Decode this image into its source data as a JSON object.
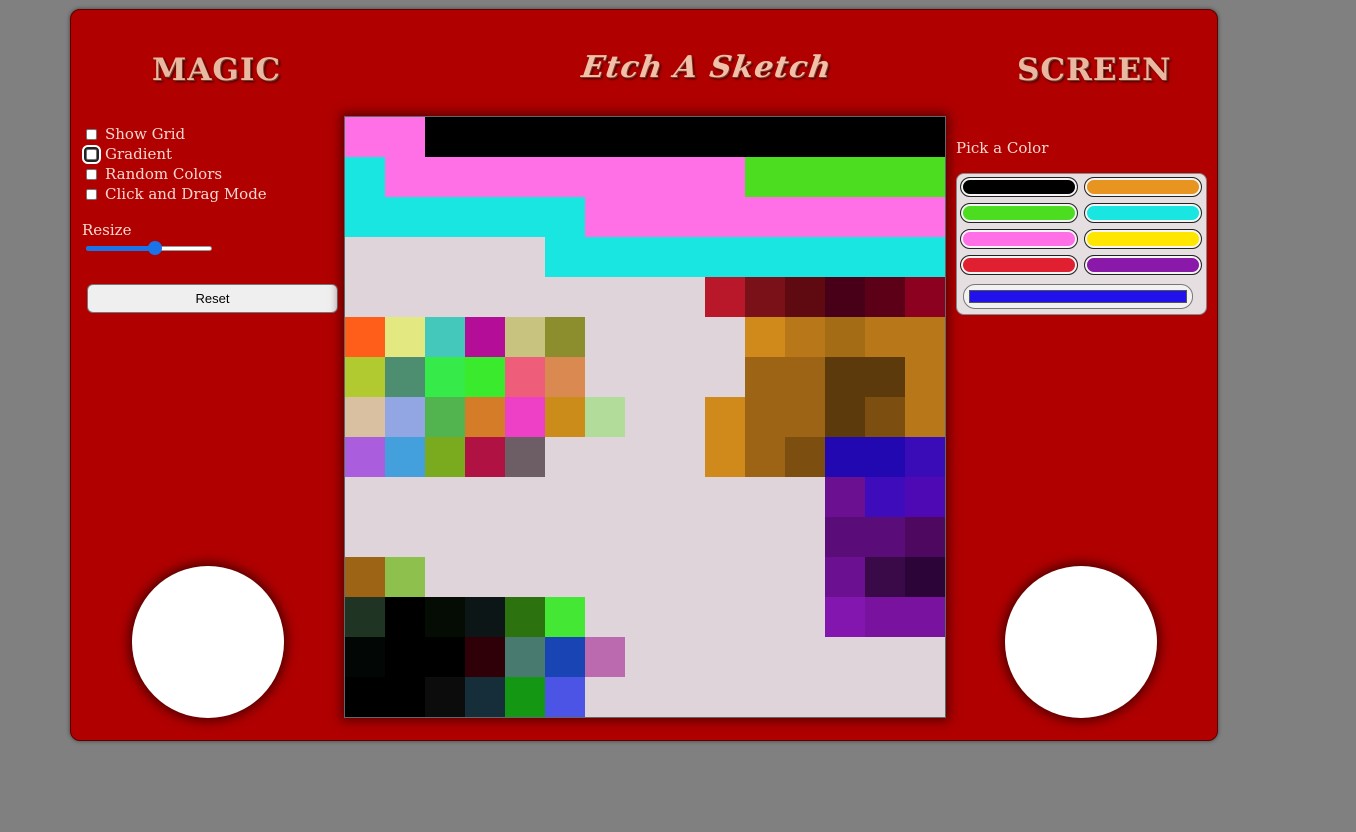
{
  "titles": {
    "left": "MAGIC",
    "center": "Etch A Sketch",
    "right": "SCREEN"
  },
  "options": [
    {
      "label": "Show Grid",
      "checked": false
    },
    {
      "label": "Gradient",
      "checked": false
    },
    {
      "label": "Random Colors",
      "checked": false
    },
    {
      "label": "Click and Drag Mode",
      "checked": false
    }
  ],
  "resize": {
    "label": "Resize",
    "value_fraction": 0.55
  },
  "reset_label": "Reset",
  "palette": {
    "label": "Pick a Color",
    "swatches": [
      "#000000",
      "#e89420",
      "#4ddd20",
      "#19e6e0",
      "#ff70e6",
      "#ffe600",
      "#e01f30",
      "#8a18a8"
    ],
    "custom_color": "#2112ec"
  },
  "grid": {
    "size": 15,
    "background": "#e0d4db",
    "cells": [
      [
        0,
        0,
        "#ff70e6"
      ],
      [
        1,
        0,
        "#ff70e6"
      ],
      [
        2,
        0,
        "#000000"
      ],
      [
        3,
        0,
        "#000000"
      ],
      [
        4,
        0,
        "#000000"
      ],
      [
        5,
        0,
        "#000000"
      ],
      [
        6,
        0,
        "#000000"
      ],
      [
        7,
        0,
        "#000000"
      ],
      [
        8,
        0,
        "#000000"
      ],
      [
        9,
        0,
        "#000000"
      ],
      [
        10,
        0,
        "#000000"
      ],
      [
        11,
        0,
        "#000000"
      ],
      [
        12,
        0,
        "#000000"
      ],
      [
        13,
        0,
        "#000000"
      ],
      [
        14,
        0,
        "#000000"
      ],
      [
        0,
        1,
        "#19e6e0"
      ],
      [
        1,
        1,
        "#ff70e6"
      ],
      [
        2,
        1,
        "#ff70e6"
      ],
      [
        3,
        1,
        "#ff70e6"
      ],
      [
        4,
        1,
        "#ff70e6"
      ],
      [
        5,
        1,
        "#ff70e6"
      ],
      [
        6,
        1,
        "#ff70e6"
      ],
      [
        7,
        1,
        "#ff70e6"
      ],
      [
        8,
        1,
        "#ff70e6"
      ],
      [
        9,
        1,
        "#ff70e6"
      ],
      [
        10,
        1,
        "#4ddd20"
      ],
      [
        11,
        1,
        "#4ddd20"
      ],
      [
        12,
        1,
        "#4ddd20"
      ],
      [
        13,
        1,
        "#4ddd20"
      ],
      [
        14,
        1,
        "#4ddd20"
      ],
      [
        0,
        2,
        "#19e6e0"
      ],
      [
        1,
        2,
        "#19e6e0"
      ],
      [
        2,
        2,
        "#19e6e0"
      ],
      [
        3,
        2,
        "#19e6e0"
      ],
      [
        4,
        2,
        "#19e6e0"
      ],
      [
        5,
        2,
        "#19e6e0"
      ],
      [
        6,
        2,
        "#ff70e6"
      ],
      [
        7,
        2,
        "#ff70e6"
      ],
      [
        8,
        2,
        "#ff70e6"
      ],
      [
        9,
        2,
        "#ff70e6"
      ],
      [
        10,
        2,
        "#ff70e6"
      ],
      [
        11,
        2,
        "#ff70e6"
      ],
      [
        12,
        2,
        "#ff70e6"
      ],
      [
        13,
        2,
        "#ff70e6"
      ],
      [
        14,
        2,
        "#ff70e6"
      ],
      [
        5,
        3,
        "#19e6e0"
      ],
      [
        6,
        3,
        "#19e6e0"
      ],
      [
        7,
        3,
        "#19e6e0"
      ],
      [
        8,
        3,
        "#19e6e0"
      ],
      [
        9,
        3,
        "#19e6e0"
      ],
      [
        10,
        3,
        "#19e6e0"
      ],
      [
        11,
        3,
        "#19e6e0"
      ],
      [
        12,
        3,
        "#19e6e0"
      ],
      [
        13,
        3,
        "#19e6e0"
      ],
      [
        14,
        3,
        "#19e6e0"
      ],
      [
        9,
        4,
        "#b8182a"
      ],
      [
        10,
        4,
        "#7a1018"
      ],
      [
        11,
        4,
        "#5e0a10"
      ],
      [
        12,
        4,
        "#480018"
      ],
      [
        13,
        4,
        "#5c0018"
      ],
      [
        14,
        4,
        "#8c0020"
      ],
      [
        0,
        5,
        "#ff5e1a"
      ],
      [
        1,
        5,
        "#e4e880"
      ],
      [
        2,
        5,
        "#44c8bc"
      ],
      [
        3,
        5,
        "#b40e98"
      ],
      [
        4,
        5,
        "#c8c480"
      ],
      [
        5,
        5,
        "#8c8e2e"
      ],
      [
        10,
        5,
        "#d08a1c"
      ],
      [
        11,
        5,
        "#b8781a"
      ],
      [
        12,
        5,
        "#a46c14"
      ],
      [
        13,
        5,
        "#b8781a"
      ],
      [
        14,
        5,
        "#b8781a"
      ],
      [
        0,
        6,
        "#b0ca30"
      ],
      [
        1,
        6,
        "#4e8e70"
      ],
      [
        2,
        6,
        "#36ea4a"
      ],
      [
        3,
        6,
        "#3aea2c"
      ],
      [
        4,
        6,
        "#ee5e7a"
      ],
      [
        5,
        6,
        "#da8a50"
      ],
      [
        10,
        6,
        "#9c6414"
      ],
      [
        11,
        6,
        "#9c6414"
      ],
      [
        12,
        6,
        "#5c3a0c"
      ],
      [
        13,
        6,
        "#5c3a0c"
      ],
      [
        14,
        6,
        "#b8781a"
      ],
      [
        0,
        7,
        "#d8c0a0"
      ],
      [
        1,
        7,
        "#92a6e4"
      ],
      [
        2,
        7,
        "#52b44e"
      ],
      [
        3,
        7,
        "#d47c28"
      ],
      [
        4,
        7,
        "#ee40c6"
      ],
      [
        5,
        7,
        "#cc8c1a"
      ],
      [
        6,
        7,
        "#b2dc9a"
      ],
      [
        9,
        7,
        "#d08a1c"
      ],
      [
        10,
        7,
        "#9c6414"
      ],
      [
        11,
        7,
        "#9c6414"
      ],
      [
        12,
        7,
        "#5c3a0c"
      ],
      [
        13,
        7,
        "#7c4e10"
      ],
      [
        14,
        7,
        "#b8781a"
      ],
      [
        0,
        8,
        "#aa5ede"
      ],
      [
        1,
        8,
        "#44a0dc"
      ],
      [
        2,
        8,
        "#7aaa1e"
      ],
      [
        3,
        8,
        "#b01244"
      ],
      [
        4,
        8,
        "#6c5e64"
      ],
      [
        9,
        8,
        "#d08a1c"
      ],
      [
        10,
        8,
        "#9c6414"
      ],
      [
        11,
        8,
        "#7c4e10"
      ],
      [
        12,
        8,
        "#2208b0"
      ],
      [
        13,
        8,
        "#2208b0"
      ],
      [
        14,
        8,
        "#3a0cb8"
      ],
      [
        12,
        9,
        "#6a1090"
      ],
      [
        13,
        9,
        "#3e0cba"
      ],
      [
        14,
        9,
        "#4e08b4"
      ],
      [
        12,
        10,
        "#5a0c78"
      ],
      [
        13,
        10,
        "#5a0c78"
      ],
      [
        14,
        10,
        "#4e0860"
      ],
      [
        0,
        11,
        "#9c6414"
      ],
      [
        1,
        11,
        "#8ec04e"
      ],
      [
        12,
        11,
        "#6a1090"
      ],
      [
        13,
        11,
        "#3a0a48"
      ],
      [
        14,
        11,
        "#2c0438"
      ],
      [
        0,
        12,
        "#203424"
      ],
      [
        1,
        12,
        "#000000"
      ],
      [
        2,
        12,
        "#040c04"
      ],
      [
        3,
        12,
        "#0c1616"
      ],
      [
        4,
        12,
        "#2c720e"
      ],
      [
        5,
        12,
        "#44e834"
      ],
      [
        12,
        12,
        "#8416b0"
      ],
      [
        13,
        12,
        "#7a12a0"
      ],
      [
        14,
        12,
        "#7a12a0"
      ],
      [
        0,
        13,
        "#020604"
      ],
      [
        1,
        13,
        "#000000"
      ],
      [
        2,
        13,
        "#000000"
      ],
      [
        3,
        13,
        "#300008"
      ],
      [
        4,
        13,
        "#487a70"
      ],
      [
        5,
        13,
        "#1844b4"
      ],
      [
        6,
        13,
        "#bc6ab0"
      ],
      [
        0,
        14,
        "#000000"
      ],
      [
        1,
        14,
        "#000000"
      ],
      [
        2,
        14,
        "#0c0c0c"
      ],
      [
        3,
        14,
        "#162e3a"
      ],
      [
        4,
        14,
        "#149814"
      ],
      [
        5,
        14,
        "#4c54e6"
      ]
    ]
  }
}
